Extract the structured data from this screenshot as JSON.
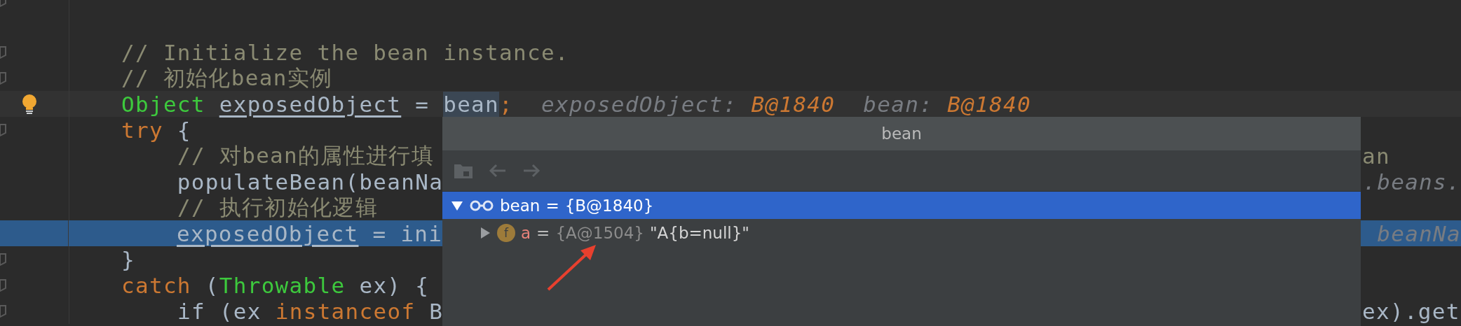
{
  "editor": {
    "lines": [
      {
        "fold": true,
        "bulb": false,
        "execution": false
      },
      {
        "fold": false,
        "bulb": false,
        "execution": false
      },
      {
        "fold": true,
        "bulb": false,
        "caret_line": false,
        "execution": false,
        "indented": false,
        "tokens": [
          {
            "kind": "comment",
            "text": "// Initialize the bean instance."
          }
        ]
      },
      {
        "fold": true,
        "bulb": false,
        "caret_line": false,
        "execution": false,
        "indented": false,
        "tokens": [
          {
            "kind": "comment",
            "text": "// 初始化bean实例"
          }
        ]
      },
      {
        "fold": false,
        "bulb": true,
        "caret_line": true,
        "execution": false,
        "indented": false,
        "tokens": [
          {
            "kind": "type",
            "text": "Object "
          },
          {
            "kind": "var",
            "text": "exposedObject"
          },
          {
            "kind": "plain",
            "text": " = "
          },
          {
            "kind": "selection",
            "text": "bean"
          },
          {
            "kind": "keyword",
            "text": ";"
          },
          {
            "kind": "hint-name",
            "text": "exposedObject:"
          },
          {
            "kind": "hint-value",
            "text": "B@1840"
          },
          {
            "kind": "hint-name",
            "text": "bean:"
          },
          {
            "kind": "hint-value",
            "text": "B@1840"
          }
        ]
      },
      {
        "fold": true,
        "bulb": false,
        "caret_line": false,
        "execution": false,
        "indented": false,
        "tokens": [
          {
            "kind": "keyword",
            "text": "try"
          },
          {
            "kind": "plain",
            "text": " {"
          }
        ]
      },
      {
        "fold": false,
        "bulb": false,
        "caret_line": false,
        "execution": false,
        "indented": true,
        "tokens": [
          {
            "kind": "comment",
            "text": "// 对bean的属性进行填"
          }
        ],
        "right": [
          {
            "kind": "comment",
            "text": "an"
          }
        ]
      },
      {
        "fold": false,
        "bulb": false,
        "caret_line": false,
        "execution": false,
        "indented": true,
        "tokens": [
          {
            "kind": "plain",
            "text": "populateBean(beanNa"
          }
        ],
        "right": [
          {
            "kind": "hint-cut",
            "text": ".beans."
          }
        ]
      },
      {
        "fold": false,
        "bulb": false,
        "caret_line": false,
        "execution": false,
        "indented": true,
        "tokens": [
          {
            "kind": "comment",
            "text": "// 执行初始化逻辑"
          }
        ]
      },
      {
        "fold": false,
        "bulb": false,
        "caret_line": false,
        "execution": true,
        "indented": true,
        "tokens": [
          {
            "kind": "var",
            "text": "exposedObject"
          },
          {
            "kind": "plain",
            "text": " = ini"
          }
        ],
        "right": [
          {
            "kind": "hint-name",
            "text": "beanNa"
          }
        ]
      },
      {
        "fold": true,
        "bulb": false,
        "caret_line": false,
        "execution": false,
        "indented": false,
        "tokens": [
          {
            "kind": "plain",
            "text": "}"
          }
        ]
      },
      {
        "fold": true,
        "bulb": false,
        "caret_line": false,
        "execution": false,
        "indented": false,
        "tokens": [
          {
            "kind": "keyword",
            "text": "catch"
          },
          {
            "kind": "plain",
            "text": " ("
          },
          {
            "kind": "type",
            "text": "Throwable"
          },
          {
            "kind": "plain",
            "text": " ex) {"
          }
        ]
      },
      {
        "fold": true,
        "bulb": false,
        "caret_line": false,
        "execution": false,
        "indented": true,
        "tokens": [
          {
            "kind": "plain",
            "text": "if (ex "
          },
          {
            "kind": "keyword",
            "text": "instanceof"
          },
          {
            "kind": "plain",
            "text": " B"
          }
        ],
        "right": [
          {
            "kind": "plain",
            "text": "ex).get"
          }
        ]
      }
    ]
  },
  "popup": {
    "title": "bean",
    "toolbar": [
      {
        "kind": "folder",
        "disabled": true
      },
      {
        "kind": "back",
        "disabled": true
      },
      {
        "kind": "forward",
        "disabled": true
      }
    ],
    "tree": [
      {
        "kind": "watch",
        "name": "bean",
        "separator": "=",
        "value": "{B@1840}",
        "expanded": true,
        "selected": true,
        "children": [
          {
            "kind": "field",
            "badge": "f",
            "name": "a",
            "separator": "=",
            "value": "{A@1504}",
            "text": "\"A{b=null}\"",
            "expanded": false,
            "selected": false
          }
        ]
      }
    ]
  }
}
